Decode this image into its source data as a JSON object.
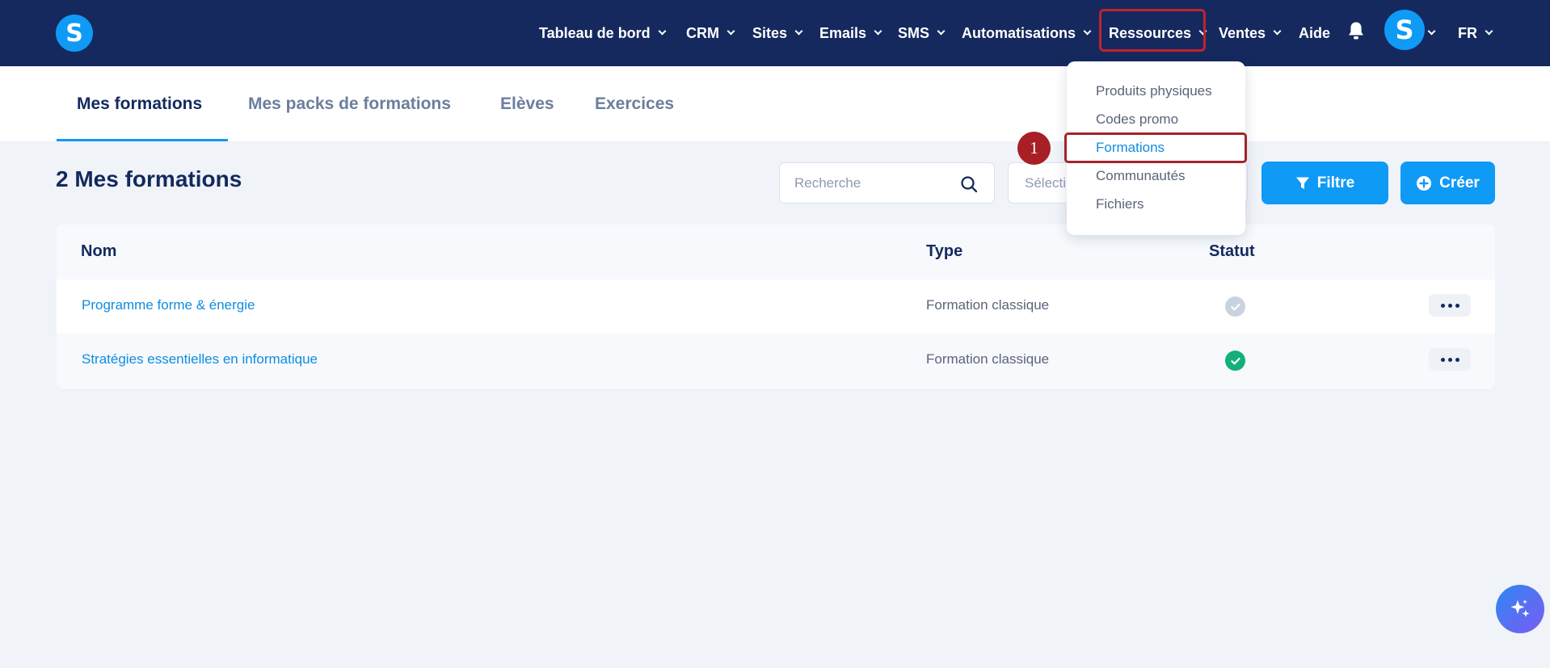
{
  "brand": {
    "logo_letter": "S",
    "accent": "#0f9af5",
    "nav_bg": "#15295e",
    "highlight": "#c0242b"
  },
  "nav": {
    "items": [
      {
        "label": "Tableau de bord",
        "has_chevron": true
      },
      {
        "label": "CRM",
        "has_chevron": true
      },
      {
        "label": "Sites",
        "has_chevron": true
      },
      {
        "label": "Emails",
        "has_chevron": true
      },
      {
        "label": "SMS",
        "has_chevron": true
      },
      {
        "label": "Automatisations",
        "has_chevron": true
      },
      {
        "label": "Ressources",
        "has_chevron": true,
        "highlighted": true
      },
      {
        "label": "Ventes",
        "has_chevron": true
      },
      {
        "label": "Aide",
        "has_chevron": false
      }
    ],
    "bell_icon": "bell-icon",
    "avatar_letter": "S",
    "language": "FR"
  },
  "tabs": [
    {
      "label": "Mes formations",
      "active": true
    },
    {
      "label": "Mes packs de formations",
      "active": false
    },
    {
      "label": "Elèves",
      "active": false
    },
    {
      "label": "Exercices",
      "active": false
    }
  ],
  "toolbar": {
    "title": "2 Mes formations",
    "search_placeholder": "Recherche",
    "select_placeholder": "Sélecti",
    "filter_label": "Filtre",
    "create_label": "Créer"
  },
  "table": {
    "columns": [
      "Nom",
      "Type",
      "Statut"
    ],
    "rows": [
      {
        "name": "Programme forme & énergie",
        "type": "Formation classique",
        "status": "inactive"
      },
      {
        "name": "Stratégies essentielles en informatique",
        "type": "Formation classique",
        "status": "active"
      }
    ]
  },
  "dropdown": {
    "items": [
      {
        "label": "Produits physiques",
        "active": false
      },
      {
        "label": "Codes promo",
        "active": false
      },
      {
        "label": "Formations",
        "active": true
      },
      {
        "label": "Communautés",
        "active": false
      },
      {
        "label": "Fichiers",
        "active": false
      }
    ]
  },
  "annotation": {
    "step": "1"
  }
}
